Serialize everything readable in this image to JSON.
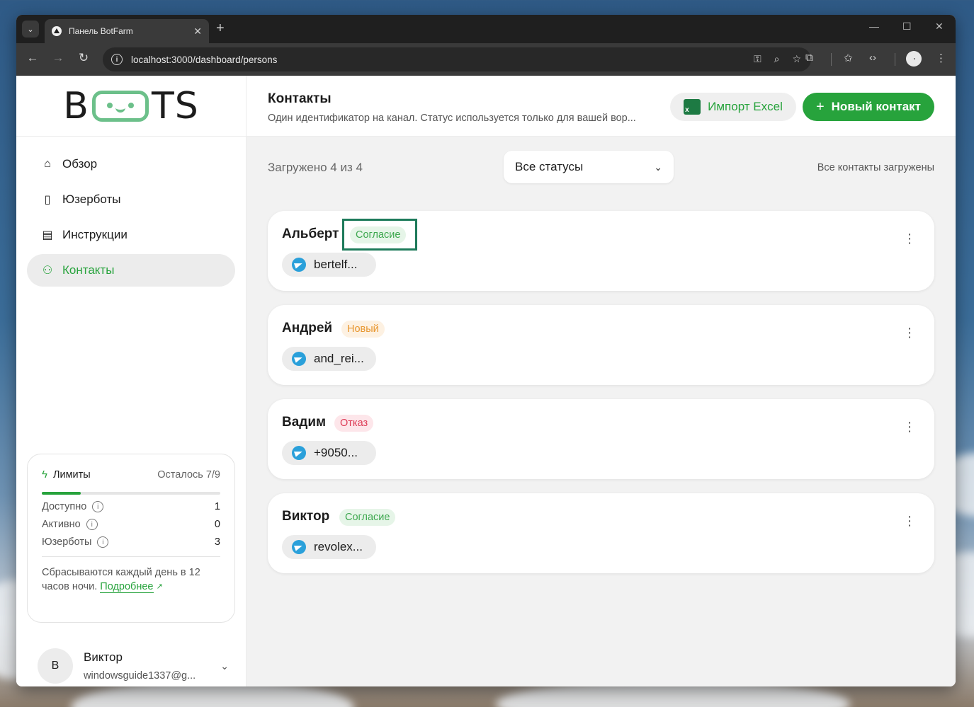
{
  "browser": {
    "tab_title": "Панель BotFarm",
    "url": "localhost:3000/dashboard/persons"
  },
  "sidebar": {
    "logo": {
      "left": "B",
      "right": "TS"
    },
    "items": [
      {
        "label": "Обзор",
        "icon": "home-icon",
        "active": false
      },
      {
        "label": "Юзерботы",
        "icon": "phone-icon",
        "active": false
      },
      {
        "label": "Инструкции",
        "icon": "document-icon",
        "active": false
      },
      {
        "label": "Контакты",
        "icon": "people-icon",
        "active": true
      }
    ],
    "limits": {
      "title": "Лимиты",
      "remaining": "Осталось 7/9",
      "progress": 0.22,
      "rows": [
        {
          "label": "Доступно",
          "value": "1"
        },
        {
          "label": "Активно",
          "value": "0"
        },
        {
          "label": "Юзерботы",
          "value": "3"
        }
      ],
      "reset_text": "Сбрасываются каждый день в 12 часов ночи.",
      "reset_link": "Подробнее"
    },
    "user": {
      "initial": "В",
      "name": "Виктор",
      "email": "windowsguide1337@g..."
    }
  },
  "header": {
    "title": "Контакты",
    "subtitle": "Один идентификатор на канал. Статус используется только для вашей вор...",
    "import_button": "Импорт Excel",
    "new_button": "Новый контакт"
  },
  "filter": {
    "loaded": "Загружено 4 из 4",
    "status_select": "Все статусы",
    "all_loaded": "Все контакты загружены"
  },
  "contacts": [
    {
      "name": "Альберт",
      "status": "Согласие",
      "status_type": "agree",
      "channel": "bertelf..."
    },
    {
      "name": "Андрей",
      "status": "Новый",
      "status_type": "new",
      "channel": "and_rei..."
    },
    {
      "name": "Вадим",
      "status": "Отказ",
      "status_type": "refuse",
      "channel": "+9050..."
    },
    {
      "name": "Виктор",
      "status": "Согласие",
      "status_type": "agree",
      "channel": "revolex..."
    }
  ],
  "colors": {
    "accent": "#27a33c",
    "highlight": "#1d7a5a"
  }
}
